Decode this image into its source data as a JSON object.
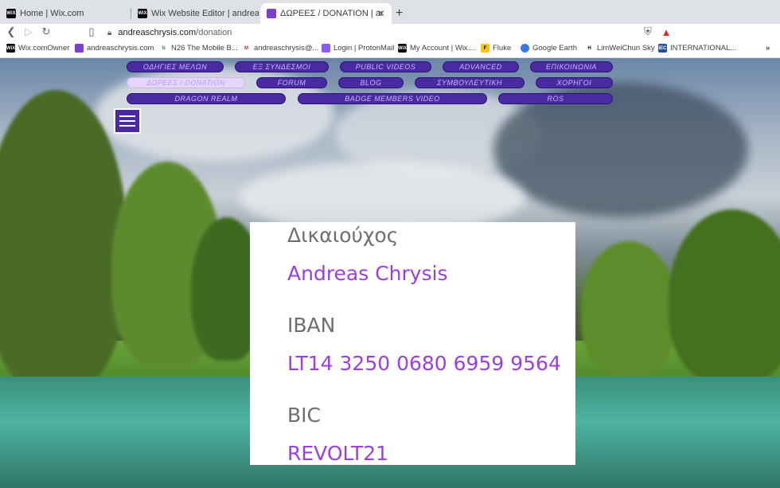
{
  "tabs": [
    {
      "title": "Home | Wix.com",
      "favicon": "wix-icon"
    },
    {
      "title": "Wix Website Editor | andreaschrysis",
      "favicon": "wix-icon"
    },
    {
      "title": "ΔΩΡΕΕΣ / DONATION | andreas",
      "favicon": "site-icon"
    }
  ],
  "address": {
    "host": "andreaschrysis.com",
    "path": "/donation"
  },
  "bookmarks": [
    {
      "label": "Wix.comOwner",
      "icon": "wix-icon"
    },
    {
      "label": "andreaschrysis.com",
      "icon": "site-icon"
    },
    {
      "label": "N26 The Mobile B...",
      "icon": "n26-icon"
    },
    {
      "label": "andreaschrysis@...",
      "icon": "gmail-icon"
    },
    {
      "label": "Login | ProtonMail",
      "icon": "protonmail-icon"
    },
    {
      "label": "My Account | Wix....",
      "icon": "wix-icon"
    },
    {
      "label": "Fluke",
      "icon": "fluke-icon"
    },
    {
      "label": "Google Earth",
      "icon": "earth-icon"
    },
    {
      "label": "LimWeiChun Sky",
      "icon": "limweichun-icon"
    },
    {
      "label": "INTERNATIONAL...",
      "icon": "iec-icon"
    }
  ],
  "menu": [
    {
      "label": "ΟΔΗΓΙΕΣ ΜΕΛΩΝ"
    },
    {
      "label": "ΕΞ ΣΥΝΔΕΣΜΟΙ"
    },
    {
      "label": "PUBLIC VIDEOS"
    },
    {
      "label": "ADVANCED"
    },
    {
      "label": "ΕΠΙΚΟΙΝΩΝΙΑ"
    },
    {
      "label": "ΔΩΡΕΕΣ / DONATION"
    },
    {
      "label": "FORUM"
    },
    {
      "label": "BLOG"
    },
    {
      "label": "ΣΥΜΒΟΥΛΕΥΤΙΚΗ"
    },
    {
      "label": "ΧΟΡΗΓΟΙ"
    },
    {
      "label": "DRAGON REALM"
    },
    {
      "label": "BADGE MEMBERS VIDEO"
    },
    {
      "label": "ROS"
    }
  ],
  "card": {
    "holder_label": "Δικαιούχος",
    "holder_value": "Andreas Chrysis",
    "iban_label": "IBAN",
    "iban_value": "LT14 3250 0680 6959 9564",
    "bic_label": "BIC",
    "bic_value": "REVOLT21"
  },
  "colors": {
    "menu_bg": "#4a2aa0",
    "accent": "#9b3fe0"
  }
}
